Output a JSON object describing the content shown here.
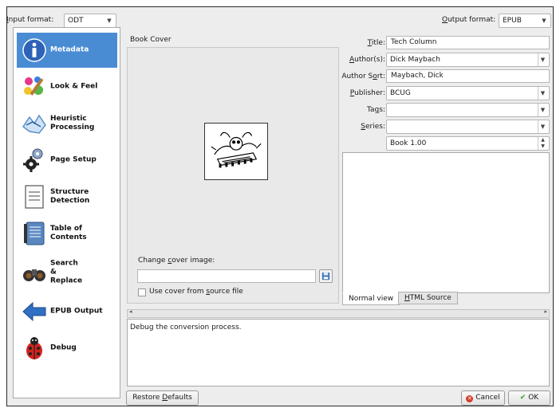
{
  "header": {
    "input_format_label": "Input format:",
    "input_format_value": "ODT",
    "output_format_label": "Output format:",
    "output_format_value": "EPUB"
  },
  "sidebar": {
    "items": [
      {
        "label": "Metadata",
        "icon": "info-icon",
        "active": true
      },
      {
        "label": "Look & Feel",
        "icon": "paint-icon"
      },
      {
        "label": "Heuristic\nProcessing",
        "icon": "heuristic-icon"
      },
      {
        "label": "Page Setup",
        "icon": "gears-icon"
      },
      {
        "label": "Structure\nDetection",
        "icon": "document-icon"
      },
      {
        "label": "Table of\nContents",
        "icon": "toc-book-icon"
      },
      {
        "label": "Search\n&\nReplace",
        "icon": "binoculars-icon"
      },
      {
        "label": "EPUB Output",
        "icon": "arrow-left-icon"
      },
      {
        "label": "Debug",
        "icon": "ladybug-icon"
      }
    ]
  },
  "cover": {
    "title": "Book Cover",
    "change_label": "Change cover image:",
    "change_value": "",
    "use_source_label": "Use cover from source file"
  },
  "meta": {
    "title_label": "Title:",
    "title_value": "Tech Column",
    "authors_label": "Author(s):",
    "authors_value": "Dick Maybach",
    "author_sort_label": "Author Sort:",
    "author_sort_value": "Maybach, Dick",
    "publisher_label": "Publisher:",
    "publisher_value": "BCUG",
    "tags_label": "Tags:",
    "tags_value": "",
    "series_label": "Series:",
    "series_value": "",
    "series_index": "Book 1.00"
  },
  "comments": {
    "tab_normal": "Normal view",
    "tab_html": "HTML Source"
  },
  "help_text": "Debug the conversion process.",
  "footer": {
    "restore_label": "Restore Defaults",
    "cancel_label": "Cancel",
    "ok_label": "OK"
  },
  "colors": {
    "accent": "#4a8cd4",
    "cancel_icon": "#d23c2a",
    "ok_icon": "#3a9a2a"
  }
}
